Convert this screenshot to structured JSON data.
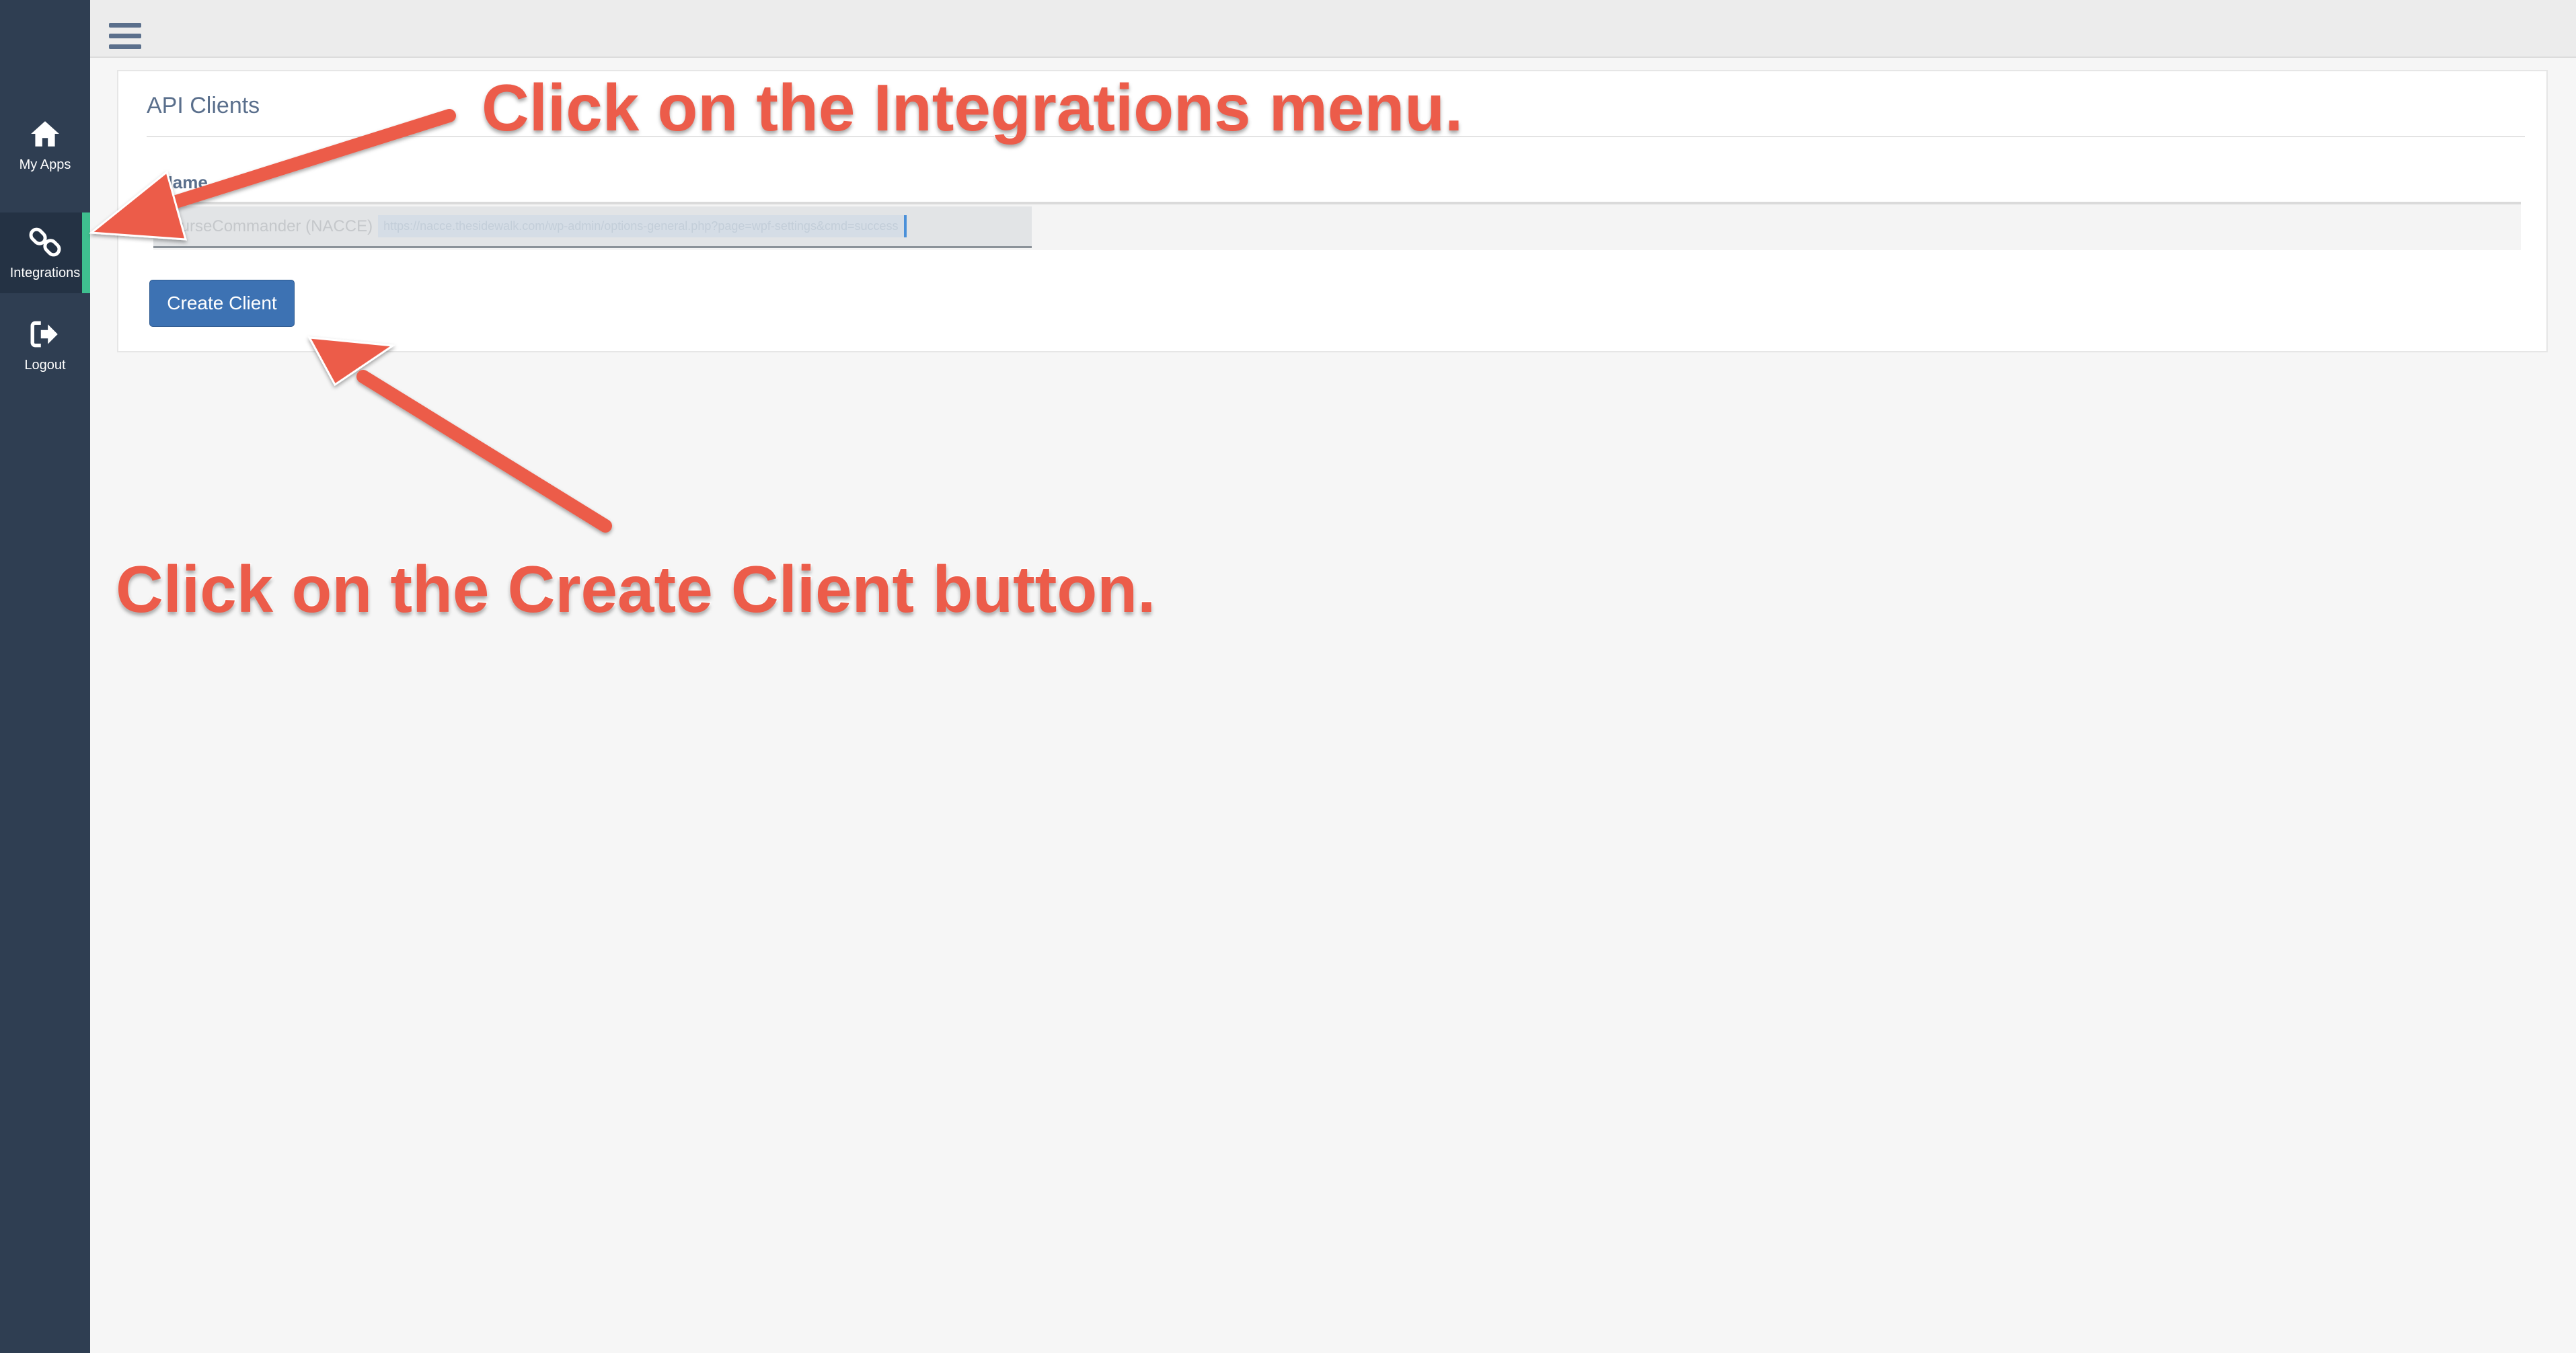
{
  "sidebar": {
    "items": [
      {
        "label": "My Apps",
        "icon": "home-icon"
      },
      {
        "label": "Integrations",
        "icon": "link-icon",
        "active": true
      },
      {
        "label": "Logout",
        "icon": "logout-icon"
      }
    ],
    "active_color": "#3fbf8f"
  },
  "topbar": {
    "menu_icon": "hamburger-menu-icon"
  },
  "panel": {
    "title": "API Clients",
    "table": {
      "columns": [
        "Name"
      ],
      "rows": [
        {
          "name": "CourseCommander (NACCE)",
          "url": "https://nacce.thesidewalk.com/wp-admin/options-general.php?page=wpf-settings&cmd=success"
        }
      ]
    },
    "create_button_label": "Create Client"
  },
  "annotations": {
    "step1": "Click on the Integrations menu.",
    "step2": "Click on the Create Client button."
  },
  "colors": {
    "annotation": "#ec5c4a",
    "primary_button": "#3d72b3",
    "sidebar_bg": "#2f3e52"
  }
}
